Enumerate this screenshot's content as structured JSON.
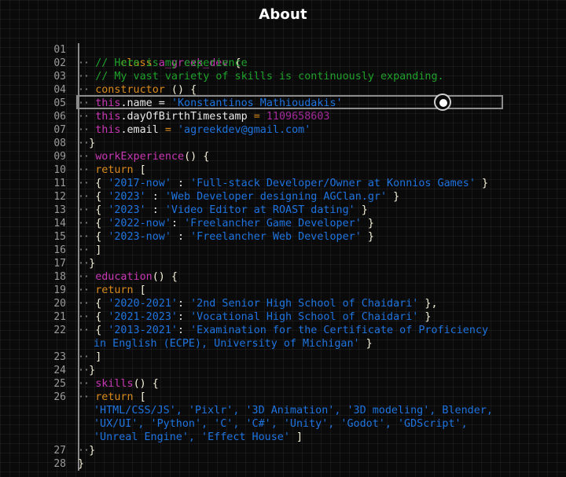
{
  "page": {
    "title": "About"
  },
  "code": {
    "line_numbers": [
      "01",
      "02",
      "03",
      "04",
      "05",
      "06",
      "07",
      "08",
      "09",
      "10",
      "11",
      "12",
      "13",
      "14",
      "15",
      "16",
      "17",
      "18",
      "19",
      "20",
      "21",
      "22",
      "23",
      "24",
      "25",
      "26",
      "27",
      "28"
    ],
    "indent_marker": "··",
    "class_keyword": "class",
    "class_name": "a_greek_dev",
    "open_brace": "{",
    "close_brace": "}",
    "comment_1": "// Here is my experience",
    "comment_2": "// My vast variety of skills is continuously expanding.",
    "constructor_keyword": "constructor",
    "constructor_parens": " () {",
    "this_keyword": "this",
    "name_field": ".name",
    "name_value": "'Konstantinos Mathioudakis'",
    "dob_field": ".dayOfBirthTimestamp",
    "dob_value": "1109658603",
    "email_field": ".email",
    "email_value": "'agreekdev@gmail.com'",
    "assign": " = ",
    "return_keyword": "return",
    "open_bracket": " [",
    "close_bracket": "]",
    "parens_open": "() {",
    "methods": {
      "work": "workExperience",
      "education": "education",
      "skills": "skills"
    },
    "work_experience": [
      {
        "period": "'2017-now'",
        "sep": " : ",
        "role": "'Full-stack Developer/Owner at Konnios Games'",
        "end": " }"
      },
      {
        "period": "'2023'",
        "sep": " : ",
        "role": "'Web Developer designing AGClan.gr'",
        "end": " }"
      },
      {
        "period": "'2023'",
        "sep": " : ",
        "role": "'Video Editor at ROAST dating'",
        "end": " }"
      },
      {
        "period": "'2022-now'",
        "sep": ": ",
        "role": "'Freelancher Game Developer'",
        "end": " }"
      },
      {
        "period": "'2023-now'",
        "sep": " : ",
        "role": "'Freelancher Web Developer'",
        "end": " }"
      }
    ],
    "education": [
      {
        "period": "'2020-2021'",
        "sep": ": ",
        "school": "'2nd Senior High School of Chaidari'",
        "end": " },",
        "wrap": ""
      },
      {
        "period": "'2021-2023'",
        "sep": ": ",
        "school": "'Vocational High School of Chaidari'",
        "end": " }",
        "wrap": ""
      },
      {
        "period": "'2013-2021'",
        "sep": ": ",
        "school": "'Examination for the Certificate of Proficiency",
        "wrap": "in English (ECPE), University of Michigan'",
        "end": " }"
      }
    ],
    "skills_lines": [
      "'HTML/CSS/JS', 'Pixlr', '3D Animation', '3D modeling', Blender,",
      "'UX/UI', 'Python', 'C', 'C#', 'Unity', 'Godot', 'GDScript',",
      "'Unreal Engine', 'Effect House'"
    ],
    "skills_end": " ]",
    "brace_open_prefix": "{ ",
    "highlighted_line": "05"
  },
  "colors": {
    "keyword_orange": "#d98a1c",
    "keyword_purple": "#c837b4",
    "comment_green": "#1fa12a",
    "string_blue": "#1e74e0",
    "number_purple": "#a3289a"
  }
}
